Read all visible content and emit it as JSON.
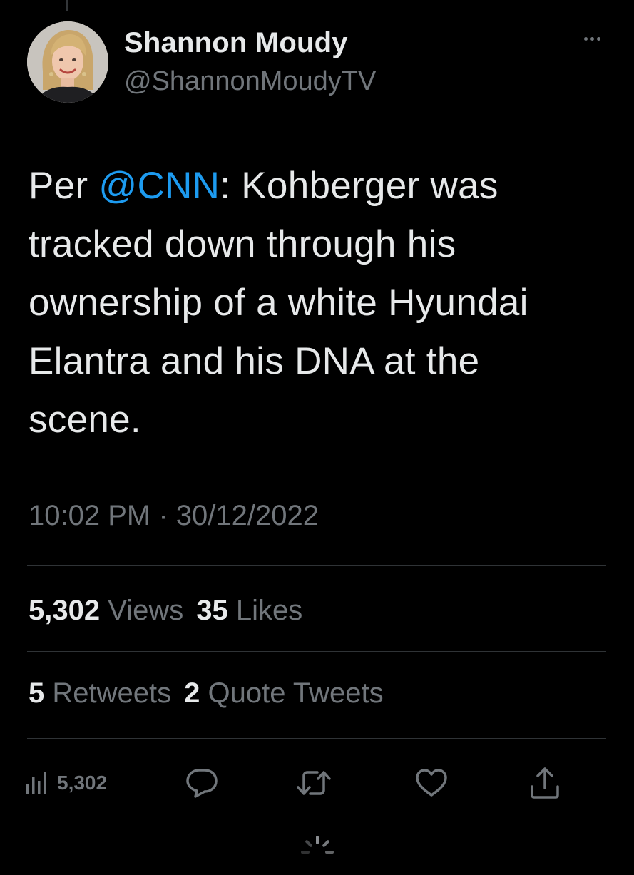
{
  "author": {
    "display_name": "Shannon Moudy",
    "handle": "@ShannonMoudyTV",
    "avatar": "profile-photo"
  },
  "tweet": {
    "text_before": "Per ",
    "mention": "@CNN",
    "text_after": ": Kohberger was tracked down through his ownership of a white Hyundai Elantra and his DNA at the scene.",
    "timestamp": "10:02 PM · 30/12/2022"
  },
  "stats": {
    "views_count": "5,302",
    "views_label": "Views",
    "likes_count": "35",
    "likes_label": "Likes",
    "retweets_count": "5",
    "retweets_label": "Retweets",
    "quotes_count": "2",
    "quotes_label": "Quote Tweets"
  },
  "actions": {
    "analytics_count": "5,302",
    "icons": [
      "analytics-icon",
      "reply-icon",
      "retweet-icon",
      "like-icon",
      "share-icon"
    ]
  },
  "colors": {
    "background": "#000000",
    "text": "#e7e9ea",
    "secondary": "#71767b",
    "link": "#1d9bf0",
    "divider": "#2f3336"
  }
}
